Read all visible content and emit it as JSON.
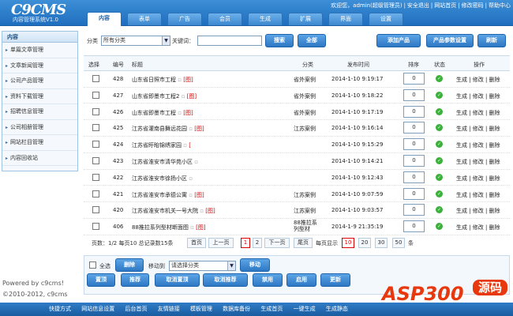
{
  "header": {
    "logo": "C9CMS",
    "subtitle": "内容管理系统V1.0",
    "toplinks": [
      "欢迎您，admin(超级管理员)",
      "|",
      "安全退出",
      "|",
      "网站首页",
      "|",
      "修改密码",
      "|",
      "帮助中心"
    ]
  },
  "nav": {
    "tabs": [
      {
        "label": "内容",
        "active": true
      },
      {
        "label": "表单"
      },
      {
        "label": "广告"
      },
      {
        "label": "会员"
      },
      {
        "label": "生成"
      },
      {
        "label": "扩展"
      },
      {
        "label": "界面"
      },
      {
        "label": "设置"
      }
    ]
  },
  "sidebar": {
    "title": "内容",
    "items": [
      {
        "label": "单篇文章管理"
      },
      {
        "label": "文章新闻管理"
      },
      {
        "label": "公司产品管理"
      },
      {
        "label": "资料下载管理"
      },
      {
        "label": "招聘信息管理"
      },
      {
        "label": "公司相册管理"
      },
      {
        "label": "网站栏目管理"
      },
      {
        "label": "内容回收站"
      }
    ]
  },
  "powered": {
    "line1": "Powered by c9cms!",
    "line2": "©2010-2012, c9cms"
  },
  "toolbar": {
    "category_label": "分类",
    "category_value": "所有分类",
    "keyword_label": "关键词：",
    "keyword_value": "",
    "search": "搜索",
    "all": "全部",
    "add": "添加产品",
    "params": "产品参数设置",
    "refresh": "刷新"
  },
  "table": {
    "headers": [
      "选择",
      "编号",
      "标题",
      "分类",
      "发布时间",
      "排序",
      "状态",
      "操作"
    ],
    "rows": [
      {
        "id": "428",
        "title": "山东省日照市工程",
        "tag": "[图]",
        "cat": "省外案例",
        "time": "2014-1-10 9:19:17",
        "sort": "0",
        "ops": "生成 | 修改 | 删除"
      },
      {
        "id": "427",
        "title": "山东省即墨市工程2",
        "tag": "[图]",
        "cat": "省外案例",
        "time": "2014-1-10 9:18:22",
        "sort": "0",
        "ops": "生成 | 修改 | 删除"
      },
      {
        "id": "426",
        "title": "山东省即墨市工程",
        "tag": "[图]",
        "cat": "省外案例",
        "time": "2014-1-10 9:17:19",
        "sort": "0",
        "ops": "生成 | 修改 | 删除"
      },
      {
        "id": "425",
        "title": "江苏省灌南县舞远花园",
        "tag": "[图]",
        "cat": "江苏案例",
        "time": "2014-1-10 9:16:14",
        "sort": "0",
        "ops": "生成 | 修改 | 删除"
      },
      {
        "id": "424",
        "title": "江苏省盱眙锦绣家园",
        "tag": "[",
        "cat": "",
        "time": "2014-1-10 9:15:29",
        "sort": "0",
        "ops": "生成 | 修改 | 删除"
      },
      {
        "id": "423",
        "title": "江苏省淮安市清华苑小区",
        "tag": "",
        "cat": "",
        "time": "2014-1-10 9:14:21",
        "sort": "0",
        "ops": "生成 | 修改 | 删除"
      },
      {
        "id": "422",
        "title": "江苏省淮安市徐扬小区",
        "tag": "",
        "cat": "",
        "time": "2014-1-10 9:12:43",
        "sort": "0",
        "ops": "生成 | 修改 | 删除"
      },
      {
        "id": "421",
        "title": "江苏省淮安市承德公寓",
        "tag": "[图]",
        "cat": "江苏案例",
        "time": "2014-1-10 9:07:59",
        "sort": "0",
        "ops": "生成 | 修改 | 删除"
      },
      {
        "id": "420",
        "title": "江苏省淮安市机关一号大院",
        "tag": "[图]",
        "cat": "江苏案例",
        "time": "2014-1-10 9:03:57",
        "sort": "0",
        "ops": "生成 | 修改 | 删除"
      },
      {
        "id": "406",
        "title": "88推拉系列型材断面图",
        "tag": "[图]",
        "cat": "88推拉系列型材",
        "time": "2014-1-9 21:35:19",
        "sort": "0",
        "ops": "生成 | 修改 | 删除"
      }
    ]
  },
  "pager": {
    "info": "页数：1/2 每页10 总记录数15条",
    "first": "首页",
    "prev": "上一页",
    "p1": "1",
    "p2": "2",
    "next": "下一页",
    "last": "尾页",
    "perpage": "每页显示",
    "s10": "10",
    "s20": "20",
    "s30": "30",
    "s50": "50",
    "unit": "条"
  },
  "bottom": {
    "selectall": "全选",
    "delete": "删除",
    "moveto": "移动到",
    "move_select": "请选择分类",
    "move": "移动",
    "recommend_top": "置顶",
    "recommend": "推荐",
    "cancel_top": "取消置顶",
    "cancel_rec": "取消推荐",
    "disable": "禁用",
    "enable": "启用",
    "update": "更新"
  },
  "footer": {
    "links": [
      "快捷方式",
      "网站信息设置",
      "后台首页",
      "友情链接",
      "模板管理",
      "数据库备份",
      "生成首页",
      "一键生成",
      "生成静态"
    ]
  },
  "watermark": {
    "text": "ASP300",
    "badge": "源码"
  }
}
